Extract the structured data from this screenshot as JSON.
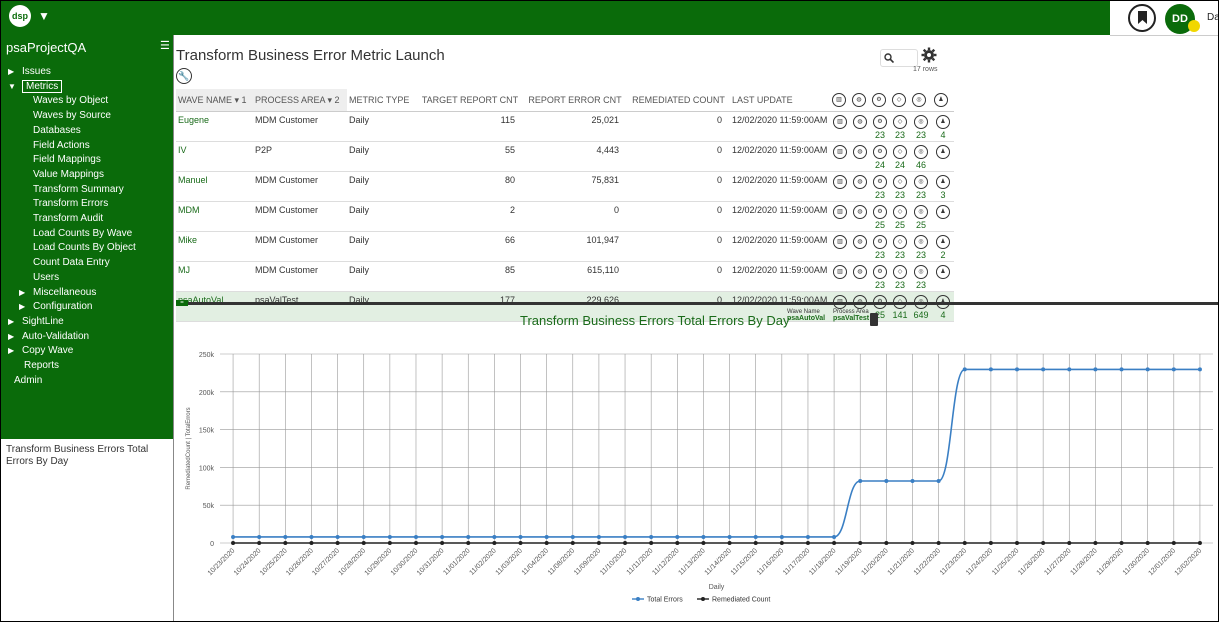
{
  "app": {
    "logo": "dsp",
    "user_initials": "DD",
    "user_name": "Da"
  },
  "sidebar": {
    "project": "psaProjectQA",
    "items": [
      {
        "label": "Issues",
        "arrow": "▶",
        "level": 0
      },
      {
        "label": "Metrics",
        "arrow": "▼",
        "level": 0,
        "selected": true
      },
      {
        "label": "Waves by Object",
        "level": 1
      },
      {
        "label": "Waves by Source",
        "level": 1
      },
      {
        "label": "Databases",
        "level": 1
      },
      {
        "label": "Field Actions",
        "level": 1
      },
      {
        "label": "Field Mappings",
        "level": 1
      },
      {
        "label": "Value Mappings",
        "level": 1
      },
      {
        "label": "Transform Summary",
        "level": 1
      },
      {
        "label": "Transform Errors",
        "level": 1
      },
      {
        "label": "Transform Audit",
        "level": 1
      },
      {
        "label": "Load Counts By Wave",
        "level": 1
      },
      {
        "label": "Load Counts By Object",
        "level": 1
      },
      {
        "label": "Count Data Entry",
        "level": 1
      },
      {
        "label": "Users",
        "level": 1
      },
      {
        "label": "Miscellaneous",
        "arrow": "▶",
        "level": 2
      },
      {
        "label": "Configuration",
        "arrow": "▶",
        "level": 2
      },
      {
        "label": "SightLine",
        "arrow": "▶",
        "level": 0
      },
      {
        "label": "Auto-Validation",
        "arrow": "▶",
        "level": 0
      },
      {
        "label": "Copy Wave",
        "arrow": "▶",
        "level": 0
      },
      {
        "label": "Reports",
        "level": 3
      },
      {
        "label": "Admin",
        "level": 4
      }
    ],
    "note": "Transform Business Errors Total Errors By Day"
  },
  "page": {
    "title": "Transform Business Error Metric Launch",
    "rows_label": "17 rows"
  },
  "table": {
    "headers": [
      "WAVE NAME ▾ 1",
      "PROCESS AREA ▾ 2",
      "METRIC TYPE",
      "TARGET REPORT CNT",
      "REPORT ERROR CNT",
      "REMEDIATED COUNT",
      "LAST UPDATE"
    ],
    "rows": [
      {
        "wave": "Eugene",
        "process": "MDM Customer",
        "type": "Daily",
        "target": "115",
        "error": "25,021",
        "remed": "0",
        "update": "12/02/2020 11:59:00AM",
        "counts": [
          "",
          "",
          "23",
          "23",
          "23",
          "4"
        ]
      },
      {
        "wave": "IV",
        "process": "P2P",
        "type": "Daily",
        "target": "55",
        "error": "4,443",
        "remed": "0",
        "update": "12/02/2020 11:59:00AM",
        "counts": [
          "",
          "",
          "24",
          "24",
          "46",
          ""
        ]
      },
      {
        "wave": "Manuel",
        "process": "MDM Customer",
        "type": "Daily",
        "target": "80",
        "error": "75,831",
        "remed": "0",
        "update": "12/02/2020 11:59:00AM",
        "counts": [
          "",
          "",
          "23",
          "23",
          "23",
          "3"
        ]
      },
      {
        "wave": "MDM",
        "process": "MDM Customer",
        "type": "Daily",
        "target": "2",
        "error": "0",
        "remed": "0",
        "update": "12/02/2020 11:59:00AM",
        "counts": [
          "",
          "",
          "25",
          "25",
          "25",
          ""
        ]
      },
      {
        "wave": "Mike",
        "process": "MDM Customer",
        "type": "Daily",
        "target": "66",
        "error": "101,947",
        "remed": "0",
        "update": "12/02/2020 11:59:00AM",
        "counts": [
          "",
          "",
          "23",
          "23",
          "23",
          "2"
        ]
      },
      {
        "wave": "MJ",
        "process": "MDM Customer",
        "type": "Daily",
        "target": "85",
        "error": "615,110",
        "remed": "0",
        "update": "12/02/2020 11:59:00AM",
        "counts": [
          "",
          "",
          "23",
          "23",
          "23",
          ""
        ]
      },
      {
        "wave": "psaAutoVal",
        "process": "psaValTest",
        "type": "Daily",
        "target": "177",
        "error": "229,626",
        "remed": "0",
        "update": "12/02/2020 11:59:00AM",
        "counts": [
          "",
          "",
          "25",
          "141",
          "649",
          "4"
        ],
        "selected": true
      }
    ],
    "icons": [
      "bar-chart-icon",
      "globe-icon",
      "gears-icon",
      "cube-icon",
      "target-icon",
      "user-icon"
    ]
  },
  "chart_filters": {
    "wave_label": "Wave Name",
    "wave_value": "psaAutoVal",
    "process_label": "Process Area",
    "process_value": "psaValTest"
  },
  "chart_data": {
    "type": "line",
    "title": "Transform Business Errors Total Errors By Day",
    "xlabel": "Daily",
    "ylabel": "RemediatedCount | TotalErrors",
    "categories": [
      "10/23/2020",
      "10/24/2020",
      "10/25/2020",
      "10/26/2020",
      "10/27/2020",
      "10/28/2020",
      "10/29/2020",
      "10/30/2020",
      "10/31/2020",
      "11/01/2020",
      "11/02/2020",
      "11/03/2020",
      "11/04/2020",
      "11/08/2020",
      "11/09/2020",
      "11/10/2020",
      "11/11/2020",
      "11/12/2020",
      "11/13/2020",
      "11/14/2020",
      "11/15/2020",
      "11/16/2020",
      "11/17/2020",
      "11/18/2020",
      "11/19/2020",
      "11/20/2020",
      "11/21/2020",
      "11/22/2020",
      "11/23/2020",
      "11/24/2020",
      "11/25/2020",
      "11/26/2020",
      "11/27/2020",
      "11/28/2020",
      "11/29/2020",
      "11/30/2020",
      "12/01/2020",
      "12/02/2020"
    ],
    "series": [
      {
        "name": "Total Errors",
        "color": "#3a7fc4",
        "values": [
          8000,
          8000,
          8000,
          8000,
          8000,
          8000,
          8000,
          8000,
          8000,
          8000,
          8000,
          8000,
          8000,
          8000,
          8000,
          8000,
          8000,
          8000,
          8000,
          8000,
          8000,
          8000,
          8000,
          8000,
          82000,
          82000,
          82000,
          82000,
          229626,
          229626,
          229626,
          229626,
          229626,
          229626,
          229626,
          229626,
          229626,
          229626
        ]
      },
      {
        "name": "Remediated Count",
        "color": "#222222",
        "values": [
          0,
          0,
          0,
          0,
          0,
          0,
          0,
          0,
          0,
          0,
          0,
          0,
          0,
          0,
          0,
          0,
          0,
          0,
          0,
          0,
          0,
          0,
          0,
          0,
          0,
          0,
          0,
          0,
          0,
          0,
          0,
          0,
          0,
          0,
          0,
          0,
          0,
          0
        ]
      }
    ],
    "yticks": [
      0,
      50000,
      100000,
      150000,
      200000,
      250000
    ],
    "ytick_labels": [
      "0",
      "50k",
      "100k",
      "150k",
      "200k",
      "250k"
    ],
    "ylim": [
      0,
      250000
    ],
    "grid": true,
    "legend": "bottom"
  }
}
